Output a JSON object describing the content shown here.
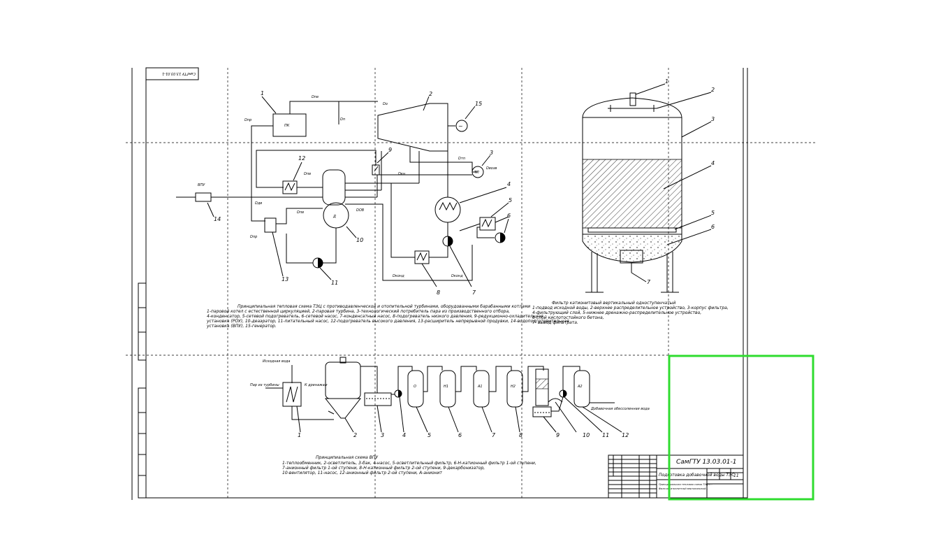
{
  "stamp": {
    "code_rotated": "СамГТУ 13.03.01-1",
    "code": "СамГТУ 13.03.01-1",
    "title": "Подготовка добавочной воды ТЭС",
    "sheet": "11",
    "desc_line1": "Принципиальная тепловая схема ТЭЦ с...",
    "desc_line2": "Фильтр катионитный вертикальный..."
  },
  "scheme1": {
    "caption": [
      "Принципиальная тепловая схема ТЭЦ с противодавленческой и отопительной турбинами, оборудованными барабанными котлами",
      "1-паровой котел с естественной циркуляцией, 2-паровая турбина, 3-технологический потребитель пара из производственного отбора,",
      "4-конденсатор, 5-сетевой подогреватель, 6-сетевой насос, 7-конденсатный насос, 8-подогреватель низкого давления, 9-редукционно-охладительная",
      "установка (РОУ), 10-деаэратор, 11-питательный насос, 12-подогреватель высокого давления, 13-расширитель непрерывной продувки, 14-водоподготовительная",
      "установка (ВПУ), 15-генератор."
    ],
    "labels": {
      "pk": "ПК",
      "vpu": "ВПУ",
      "d": "Д",
      "tp": "ТП",
      "d_pe": "Dпе",
      "d_o": "Dо",
      "d_p": "Dп",
      "d_pr": "Dпр",
      "d_dv": "Dдв",
      "d_pv": "Dпв",
      "d_ov": "DОВ",
      "d_tp": "Dтп",
      "d_vozv": "Dвозв",
      "d_kond": "Dконд",
      "d_kn": "Dкн"
    }
  },
  "scheme2": {
    "caption": [
      "Фильтр катионитовый вертикальный одноступенчатый",
      "1-подвод исходной воды, 2-верхнее распределительное устройство, 3-корпус фильтра,",
      "4-фильтрующий слой, 5-нижнее дренажно-распределительное устройство,",
      "6-слой кислотостойкого бетона,",
      "7- вывод фильтрата."
    ]
  },
  "scheme3": {
    "caption": [
      "Принципиальная схема ВПУ",
      "1-теплообменник, 2-осветлитель, 3-бак, 4-насос, 5-осветлительный фильтр, 6-Н-катионный фильтр 1-ой ступени,",
      "7-анионный фильтр 1-ой ступени, 8-Н-катионный фильтр 2-ой ступени, 9-декарбонизатор,",
      "10-вентилятор, 11-насос, 12-анионный фильтр 2-ой ступени, А-анионит"
    ],
    "labels": {
      "raw_water": "Исходная вода",
      "steam": "Пар из турбины",
      "condensate": "К дренажам",
      "output": "Добавочная обессоленная вода",
      "f5": "О",
      "f6": "Н1",
      "f7": "А1",
      "f8": "Н2",
      "f12": "А2"
    }
  }
}
